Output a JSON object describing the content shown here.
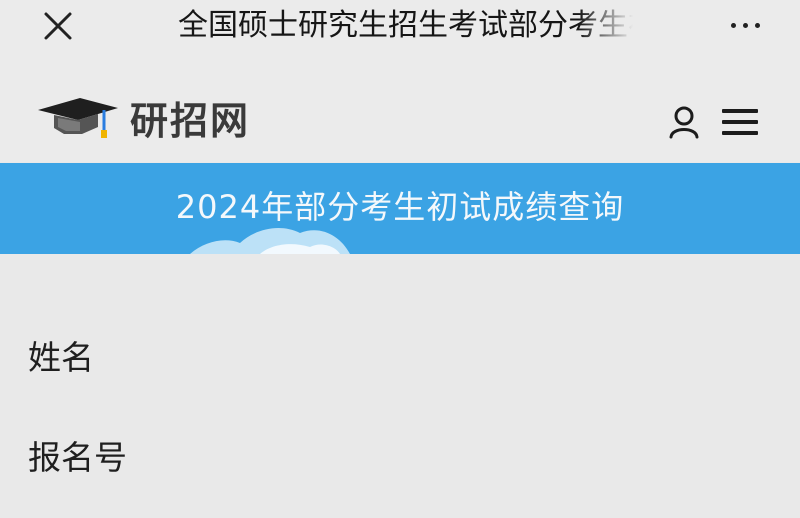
{
  "window": {
    "title": "全国硕士研究生招生考试部分考生初试成绩查询",
    "close_icon": "close-icon",
    "more_icon": "more-horizontal-icon"
  },
  "site": {
    "logo_text": "研招网",
    "logo_icon": "graduation-cap-icon",
    "user_icon": "user-icon",
    "menu_icon": "hamburger-menu-icon"
  },
  "banner": {
    "title": "2024年部分考生初试成绩查询",
    "color": "#3ba3e4"
  },
  "form": {
    "fields": [
      {
        "label": "姓名",
        "value": ""
      },
      {
        "label": "报名号",
        "value": ""
      }
    ]
  }
}
